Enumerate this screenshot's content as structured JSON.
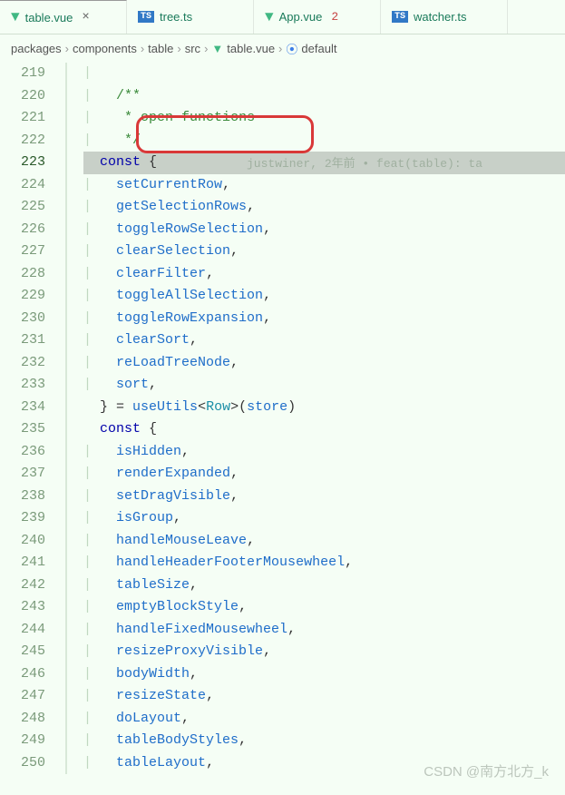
{
  "tabs": [
    {
      "name": "table.vue",
      "type": "vue",
      "active": true,
      "close": "×"
    },
    {
      "name": "tree.ts",
      "type": "ts",
      "active": false
    },
    {
      "name": "App.vue",
      "type": "vue",
      "active": false,
      "badge": "2"
    },
    {
      "name": "watcher.ts",
      "type": "ts",
      "active": false
    }
  ],
  "breadcrumb": {
    "items": [
      "packages",
      "components",
      "table",
      "src",
      "table.vue",
      "default"
    ],
    "sep": "›"
  },
  "lines": {
    "start": 219,
    "active": 223,
    "blame": "justwiner, 2年前 • feat(table): ta",
    "code": [
      {
        "n": 219,
        "indent": "    ",
        "t": ""
      },
      {
        "n": 220,
        "indent": "    ",
        "t": [
          [
            "comment",
            "/**"
          ]
        ]
      },
      {
        "n": 221,
        "indent": "     ",
        "t": [
          [
            "comment",
            "* "
          ],
          [
            "comment",
            "open functions"
          ]
        ]
      },
      {
        "n": 222,
        "indent": "     ",
        "t": [
          [
            "comment",
            "*/"
          ]
        ]
      },
      {
        "n": 223,
        "indent": "  ",
        "hl": true,
        "t": [
          [
            "keyword",
            "const"
          ],
          [
            "punct",
            " {"
          ]
        ]
      },
      {
        "n": 224,
        "indent": "    ",
        "t": [
          [
            "identifier",
            "setCurrentRow"
          ],
          [
            "punct",
            ","
          ]
        ]
      },
      {
        "n": 225,
        "indent": "    ",
        "t": [
          [
            "identifier",
            "getSelectionRows"
          ],
          [
            "punct",
            ","
          ]
        ]
      },
      {
        "n": 226,
        "indent": "    ",
        "t": [
          [
            "identifier",
            "toggleRowSelection"
          ],
          [
            "punct",
            ","
          ]
        ]
      },
      {
        "n": 227,
        "indent": "    ",
        "t": [
          [
            "identifier",
            "clearSelection"
          ],
          [
            "punct",
            ","
          ]
        ]
      },
      {
        "n": 228,
        "indent": "    ",
        "t": [
          [
            "identifier",
            "clearFilter"
          ],
          [
            "punct",
            ","
          ]
        ]
      },
      {
        "n": 229,
        "indent": "    ",
        "t": [
          [
            "identifier",
            "toggleAllSelection"
          ],
          [
            "punct",
            ","
          ]
        ]
      },
      {
        "n": 230,
        "indent": "    ",
        "t": [
          [
            "identifier",
            "toggleRowExpansion"
          ],
          [
            "punct",
            ","
          ]
        ]
      },
      {
        "n": 231,
        "indent": "    ",
        "t": [
          [
            "identifier",
            "clearSort"
          ],
          [
            "punct",
            ","
          ]
        ]
      },
      {
        "n": 232,
        "indent": "    ",
        "t": [
          [
            "identifier",
            "reLoadTreeNode"
          ],
          [
            "punct",
            ","
          ]
        ]
      },
      {
        "n": 233,
        "indent": "    ",
        "t": [
          [
            "identifier",
            "sort"
          ],
          [
            "punct",
            ","
          ]
        ]
      },
      {
        "n": 234,
        "indent": "  ",
        "t": [
          [
            "punct",
            "} = "
          ],
          [
            "identifier",
            "useUtils"
          ],
          [
            "punct",
            "<"
          ],
          [
            "generic",
            "Row"
          ],
          [
            "punct",
            ">("
          ],
          [
            "identifier",
            "store"
          ],
          [
            "punct",
            ")"
          ]
        ]
      },
      {
        "n": 235,
        "indent": "  ",
        "t": [
          [
            "keyword",
            "const"
          ],
          [
            "punct",
            " {"
          ]
        ]
      },
      {
        "n": 236,
        "indent": "    ",
        "t": [
          [
            "identifier",
            "isHidden"
          ],
          [
            "punct",
            ","
          ]
        ]
      },
      {
        "n": 237,
        "indent": "    ",
        "t": [
          [
            "identifier",
            "renderExpanded"
          ],
          [
            "punct",
            ","
          ]
        ]
      },
      {
        "n": 238,
        "indent": "    ",
        "t": [
          [
            "identifier",
            "setDragVisible"
          ],
          [
            "punct",
            ","
          ]
        ]
      },
      {
        "n": 239,
        "indent": "    ",
        "t": [
          [
            "identifier",
            "isGroup"
          ],
          [
            "punct",
            ","
          ]
        ]
      },
      {
        "n": 240,
        "indent": "    ",
        "t": [
          [
            "identifier",
            "handleMouseLeave"
          ],
          [
            "punct",
            ","
          ]
        ]
      },
      {
        "n": 241,
        "indent": "    ",
        "t": [
          [
            "identifier",
            "handleHeaderFooterMousewheel"
          ],
          [
            "punct",
            ","
          ]
        ]
      },
      {
        "n": 242,
        "indent": "    ",
        "t": [
          [
            "identifier",
            "tableSize"
          ],
          [
            "punct",
            ","
          ]
        ]
      },
      {
        "n": 243,
        "indent": "    ",
        "t": [
          [
            "identifier",
            "emptyBlockStyle"
          ],
          [
            "punct",
            ","
          ]
        ]
      },
      {
        "n": 244,
        "indent": "    ",
        "t": [
          [
            "identifier",
            "handleFixedMousewheel"
          ],
          [
            "punct",
            ","
          ]
        ]
      },
      {
        "n": 245,
        "indent": "    ",
        "t": [
          [
            "identifier",
            "resizeProxyVisible"
          ],
          [
            "punct",
            ","
          ]
        ]
      },
      {
        "n": 246,
        "indent": "    ",
        "t": [
          [
            "identifier",
            "bodyWidth"
          ],
          [
            "punct",
            ","
          ]
        ]
      },
      {
        "n": 247,
        "indent": "    ",
        "t": [
          [
            "identifier",
            "resizeState"
          ],
          [
            "punct",
            ","
          ]
        ]
      },
      {
        "n": 248,
        "indent": "    ",
        "t": [
          [
            "identifier",
            "doLayout"
          ],
          [
            "punct",
            ","
          ]
        ]
      },
      {
        "n": 249,
        "indent": "    ",
        "t": [
          [
            "identifier",
            "tableBodyStyles"
          ],
          [
            "punct",
            ","
          ]
        ]
      },
      {
        "n": 250,
        "indent": "    ",
        "t": [
          [
            "identifier",
            "tableLayout"
          ],
          [
            "punct",
            ","
          ]
        ]
      }
    ]
  },
  "watermark": "CSDN @南方北方_k"
}
